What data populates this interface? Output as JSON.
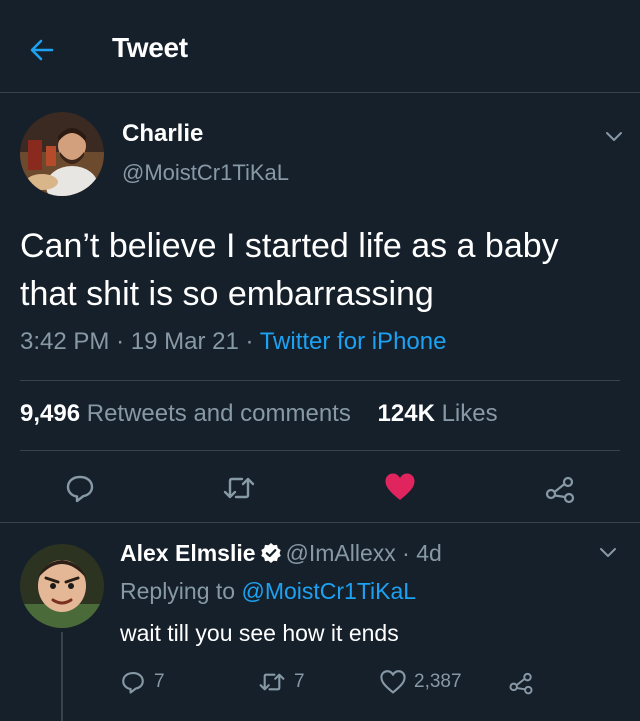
{
  "header": {
    "title": "Tweet",
    "back_icon": "arrow-left-icon"
  },
  "tweet": {
    "author_name": "Charlie",
    "author_handle": "@MoistCr1TiKaL",
    "text": "Can’t believe I started life as a baby that shit is so embarrassing",
    "time": "3:42 PM",
    "date": "19 Mar 21",
    "separator": "·",
    "source": "Twitter for iPhone",
    "retweets_count": "9,496",
    "retweets_label": "Retweets and comments",
    "likes_count": "124K",
    "likes_label": "Likes",
    "liked": true
  },
  "actions": [
    "reply-icon",
    "retweet-icon",
    "heart-icon",
    "share-icon"
  ],
  "reply": {
    "author_name": "Alex Elmslie",
    "verified": true,
    "author_handle": "@ImAllexx",
    "separator": "·",
    "age": "4d",
    "replying_label": "Replying to",
    "replying_handle": "@MoistCr1TiKaL",
    "text": "wait till you see how it ends",
    "reply_count": "7",
    "retweet_count": "7",
    "like_count": "2,387"
  },
  "colors": {
    "background": "#15202b",
    "divider": "#38444d",
    "secondary_text": "#8899a6",
    "accent": "#1da1f2",
    "like": "#e0245e"
  }
}
